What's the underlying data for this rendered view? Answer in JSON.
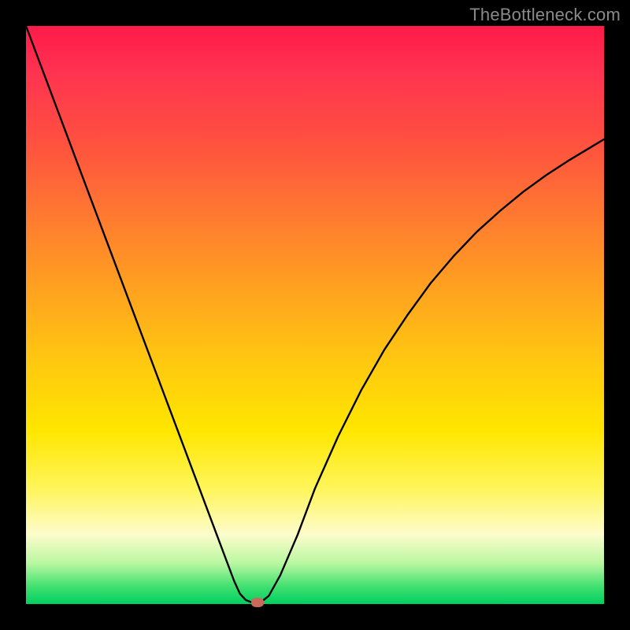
{
  "watermark": "TheBottleneck.com",
  "chart_data": {
    "type": "line",
    "title": "",
    "xlabel": "",
    "ylabel": "",
    "xlim": [
      0,
      100
    ],
    "ylim": [
      0,
      100
    ],
    "grid": false,
    "legend": false,
    "series": [
      {
        "name": "curve",
        "x": [
          0,
          3,
          6,
          9,
          12,
          15,
          18,
          21,
          24,
          27,
          30,
          33,
          36,
          37,
          38,
          39,
          40,
          41,
          42,
          44,
          47,
          50,
          54,
          58,
          62,
          66,
          70,
          74,
          78,
          82,
          86,
          90,
          94,
          98,
          100
        ],
        "y": [
          100,
          92,
          84,
          76,
          68,
          60,
          52,
          44,
          36,
          28,
          20,
          12,
          4,
          1.8,
          0.7,
          0.3,
          0.3,
          0.6,
          1.4,
          5,
          12,
          20,
          29,
          37,
          44,
          50,
          55.5,
          60.2,
          64.4,
          68,
          71.3,
          74.2,
          76.8,
          79.2,
          80.4
        ]
      }
    ],
    "marker": {
      "x": 40,
      "y": 0.3,
      "color": "#c76a5a"
    }
  },
  "colors": {
    "frame_bg": "#000000",
    "curve": "#000000"
  }
}
